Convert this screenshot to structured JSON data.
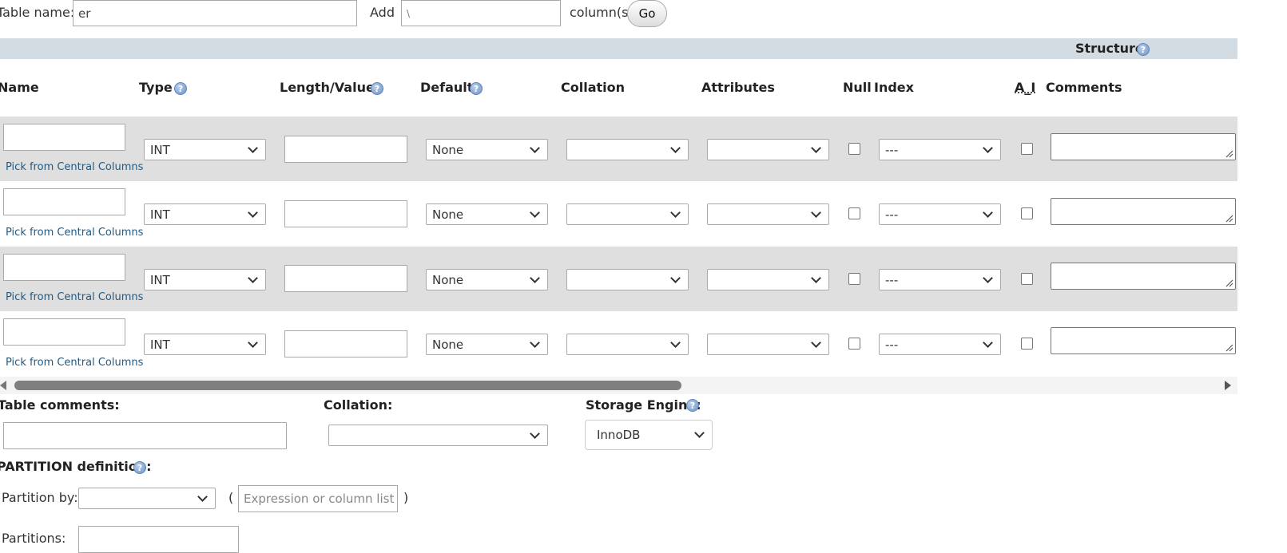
{
  "top_bar": {
    "table_name_label": "Table name:",
    "table_name_value": "er",
    "add_label": "Add",
    "add_value": "\\",
    "columns_label": "column(s)",
    "go_label": "Go"
  },
  "structure_header": {
    "title": "Structure",
    "help_icon": "help-icon"
  },
  "columns": {
    "name": "Name",
    "type": "Type",
    "length_values": "Length/Values",
    "default": "Default",
    "collation": "Collation",
    "attributes": "Attributes",
    "null": "Null",
    "index": "Index",
    "ai": "A_I",
    "comments": "Comments"
  },
  "rows": [
    {
      "type": "INT",
      "default": "None",
      "collation": "",
      "attributes": "",
      "index": "---",
      "pick_link": "Pick from Central Columns"
    },
    {
      "type": "INT",
      "default": "None",
      "collation": "",
      "attributes": "",
      "index": "---",
      "pick_link": "Pick from Central Columns"
    },
    {
      "type": "INT",
      "default": "None",
      "collation": "",
      "attributes": "",
      "index": "---",
      "pick_link": "Pick from Central Columns"
    },
    {
      "type": "INT",
      "default": "None",
      "collation": "",
      "attributes": "",
      "index": "---",
      "pick_link": "Pick from Central Columns"
    }
  ],
  "bottom": {
    "table_comments_label": "Table comments:",
    "collation_label": "Collation:",
    "collation_value": "",
    "storage_engine_label": "Storage Engine:",
    "storage_engine_value": "InnoDB",
    "partition_label": "PARTITION definition:",
    "partition_by_label": "Partition by:",
    "partition_by_value": "",
    "paren_open": "(",
    "expression_placeholder": "Expression or column list",
    "paren_close": ")",
    "partitions_label": "Partitions:"
  },
  "colors": {
    "structure_bar": "#d3dce3",
    "row_shaded": "#dfdfdf",
    "row_plain": "#ffffff",
    "link": "#235a81",
    "scrollbar_thumb": "#7f7f7f"
  }
}
